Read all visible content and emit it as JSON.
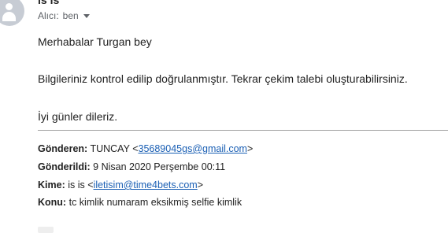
{
  "header": {
    "sender_name": "is is",
    "recipient_label": "Alıcı:",
    "recipient_value": "ben"
  },
  "message": {
    "greeting": "Merhabalar Turgan bey",
    "body": "Bilgileriniz kontrol edilip doğrulanmıştır. Tekrar çekim talebi oluşturabilirsiniz.",
    "closing": "İyi günler dileriz."
  },
  "forwarded": {
    "from_label": "Gönderen:",
    "from_name": "TUNCAY",
    "from_email": "35689045gs@gmail.com",
    "sent_label": "Gönderildi:",
    "sent_value": "9 Nisan 2020 Perşembe 00:11",
    "to_label": "Kime:",
    "to_name": "is is",
    "to_email": "iletisim@time4bets.com",
    "subject_label": "Konu:",
    "subject_value": "tc kimlik numaram eksikmiş selfie kimlik"
  },
  "icons": {
    "avatar": "default-user-avatar-icon",
    "dropdown": "chevron-down-icon"
  },
  "colors": {
    "link": "#1a5fb4",
    "secondary_text": "#5f6368"
  }
}
